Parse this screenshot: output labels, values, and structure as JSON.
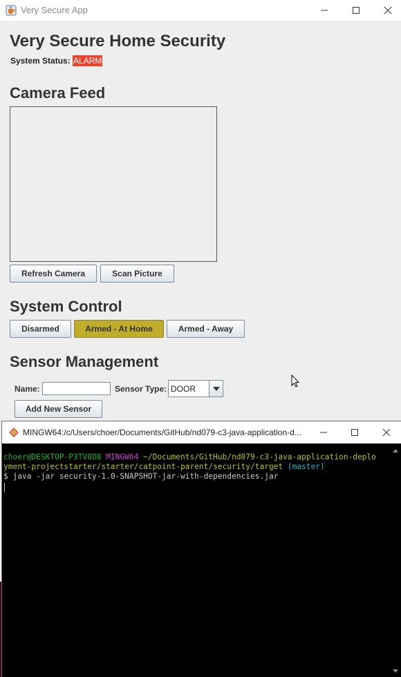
{
  "app": {
    "window_title": "Very Secure App",
    "heading": "Very Secure Home Security",
    "status_label": "System Status:",
    "status_value": "ALARM",
    "status_color": "#e8432f",
    "camera": {
      "heading": "Camera Feed",
      "refresh_label": "Refresh Camera",
      "scan_label": "Scan Picture"
    },
    "control": {
      "heading": "System Control",
      "buttons": [
        "Disarmed",
        "Armed - At Home",
        "Armed - Away"
      ],
      "active": "Armed - At Home",
      "active_color": "#c0ad2c"
    },
    "sensors": {
      "heading": "Sensor Management",
      "name_label": "Name:",
      "name_value": "",
      "type_label": "Sensor Type:",
      "type_value": "DOOR",
      "add_label": "Add New Sensor"
    }
  },
  "terminal": {
    "title": "MINGW64:/c/Users/choer/Documents/GitHub/nd079-c3-java-application-d...",
    "user_host": "choer@DESKTOP-P3TV8O8",
    "shell": "MINGW64",
    "path_line1": "~/Documents/GitHub/nd079-c3-java-application-deplo",
    "path_line2": "yment-projectstarter/starter/catpoint-parent/security/target",
    "branch": "(master)",
    "prompt": "$",
    "command": "java -jar security-1.0-SNAPSHOT-jar-with-dependencies.jar"
  },
  "icons": {
    "app_icon": "java-cup-icon",
    "terminal_icon": "git-diamond-icon",
    "cursor": "mouse-pointer-icon"
  }
}
